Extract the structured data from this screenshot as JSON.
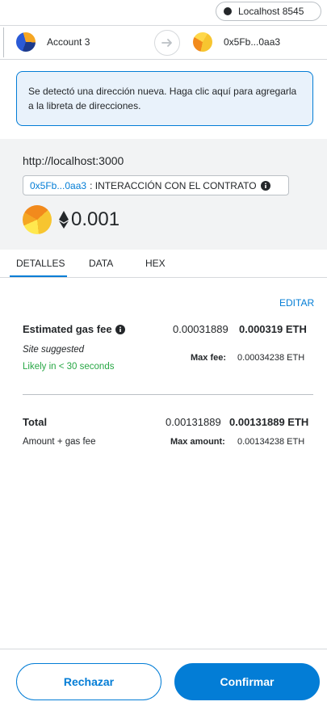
{
  "network": {
    "label": "Localhost 8545",
    "dot_color": "#24272a"
  },
  "accounts": {
    "from_name": "Account 3",
    "to_name": "0x5Fb...0aa3"
  },
  "notice": {
    "text": "Se detectó una dirección nueva. Haga clic aquí para agregarla a la libreta de direcciones."
  },
  "site": {
    "origin": "http://localhost:3000",
    "contract_address": "0x5Fb...0aa3",
    "method_label": ": INTERACCIÓN CON EL CONTRATO",
    "amount": "0.001"
  },
  "tabs": [
    {
      "label": "DETALLES",
      "active": true
    },
    {
      "label": "DATA",
      "active": false
    },
    {
      "label": "HEX",
      "active": false
    }
  ],
  "details": {
    "edit_label": "EDITAR",
    "gas_title": "Estimated gas fee",
    "gas_value_light": "0.00031889",
    "gas_value_bold": "0.000319 ETH",
    "site_suggested": "Site suggested",
    "max_fee_label": "Max fee:",
    "max_fee_value": "0.00034238 ETH",
    "likely": "Likely in < 30 seconds",
    "total_title": "Total",
    "total_light": "0.00131889",
    "total_bold": "0.00131889 ETH",
    "amount_gas_label": "Amount + gas fee",
    "max_amount_label": "Max amount:",
    "max_amount_value": "0.00134238 ETH"
  },
  "footer": {
    "reject_label": "Rechazar",
    "confirm_label": "Confirmar"
  },
  "colors": {
    "accent": "#037dd6",
    "success": "#28a745",
    "notice_bg": "#e9f2fb"
  }
}
